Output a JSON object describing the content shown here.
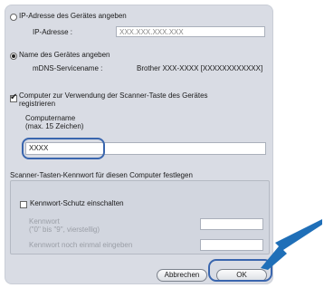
{
  "ip_option": {
    "label": "IP-Adresse des Gerätes angeben",
    "selected": false
  },
  "ip_field": {
    "label": "IP-Adresse :",
    "placeholder": "XXX.XXX.XXX.XXX"
  },
  "name_option": {
    "label": "Name des Gerätes angeben",
    "selected": true
  },
  "mdns": {
    "label": "mDNS-Servicename :",
    "value": "Brother XXX-XXXX  [XXXXXXXXXXXX]"
  },
  "register_checkbox": {
    "line1": "Computer zur Verwendung der Scanner-Taste des Gerätes",
    "line2": "registrieren",
    "checked": true
  },
  "computer_name": {
    "label": "Computername",
    "hint": "(max. 15 Zeichen)",
    "value": "XXXX"
  },
  "password_section": {
    "title": "Scanner-Tasten-Kennwort für diesen Computer festlegen",
    "enable_checkbox": {
      "label": "Kennwort-Schutz einschalten",
      "checked": false
    },
    "password_label": "Kennwort",
    "password_hint": "(\"0\" bis \"9\", vierstellig)",
    "confirm_label": "Kennwort noch einmal eingeben"
  },
  "buttons": {
    "cancel": "Abbrechen",
    "ok": "OK"
  },
  "colors": {
    "highlight": "#3a66ae",
    "arrow": "#1f6fb8",
    "dialog_bg": "#d9dce4"
  }
}
